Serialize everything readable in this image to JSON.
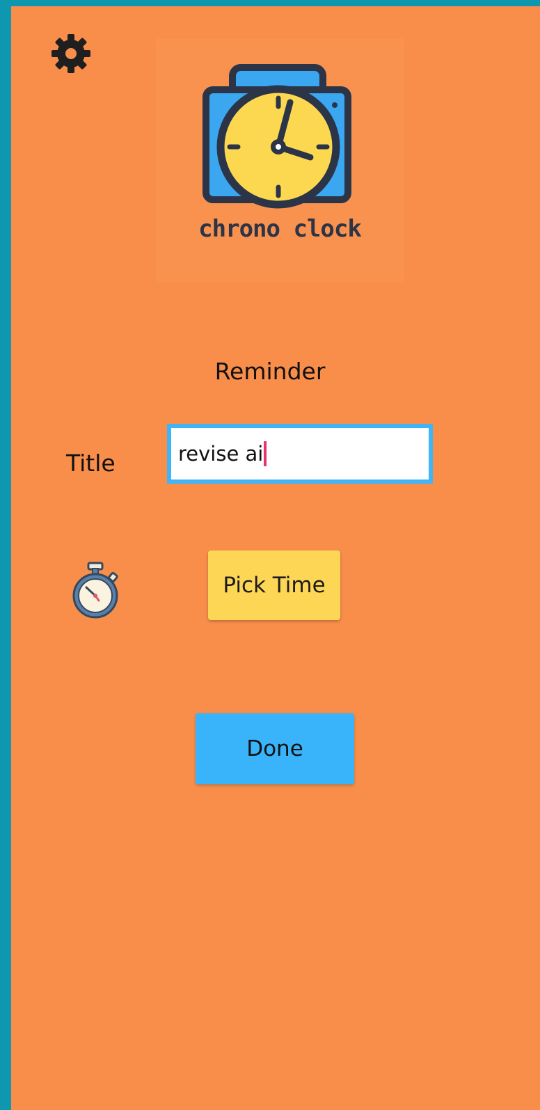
{
  "app": {
    "logo_text": "chrono clock",
    "settings_icon": "gear-icon"
  },
  "form": {
    "heading": "Reminder",
    "title_label": "Title",
    "title_value": "revise ai",
    "stopwatch_icon": "stopwatch-icon",
    "pick_time_label": "Pick Time",
    "done_label": "Done"
  },
  "colors": {
    "background": "#f98e4b",
    "frame": "#0e97ae",
    "input_border": "#3fb4f6",
    "pick_time_button": "#fed656",
    "done_button": "#39b4fa",
    "caret": "#e8336f"
  }
}
